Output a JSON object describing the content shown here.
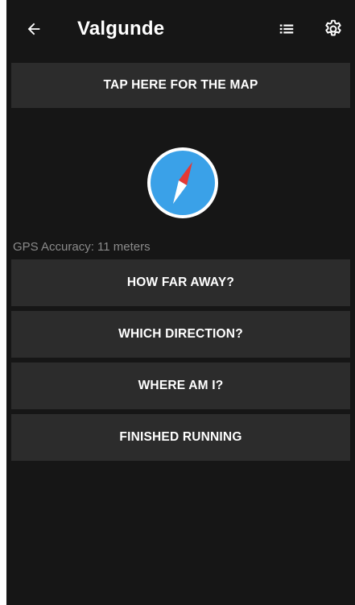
{
  "app": {
    "title": "Valgunde"
  },
  "toolbar": {
    "back_icon": "arrow-left-icon",
    "list_icon": "list-icon",
    "settings_icon": "gear-icon"
  },
  "buttons": {
    "map": "TAP HERE FOR THE MAP",
    "how_far": "HOW FAR AWAY?",
    "which_direction": "WHICH DIRECTION?",
    "where_am_i": "WHERE AM I?",
    "finished": "FINISHED RUNNING"
  },
  "status": {
    "gps_accuracy": "GPS Accuracy: 11 meters"
  },
  "compass": {
    "icon": "compass-icon"
  },
  "colors": {
    "background": "#161616",
    "button": "#2c2c2c",
    "compass_ring": "#ffffff",
    "compass_face": "#3aa1e8",
    "needle_north": "#e53935",
    "needle_south": "#ffffff",
    "muted_text": "#8a8a8a"
  }
}
